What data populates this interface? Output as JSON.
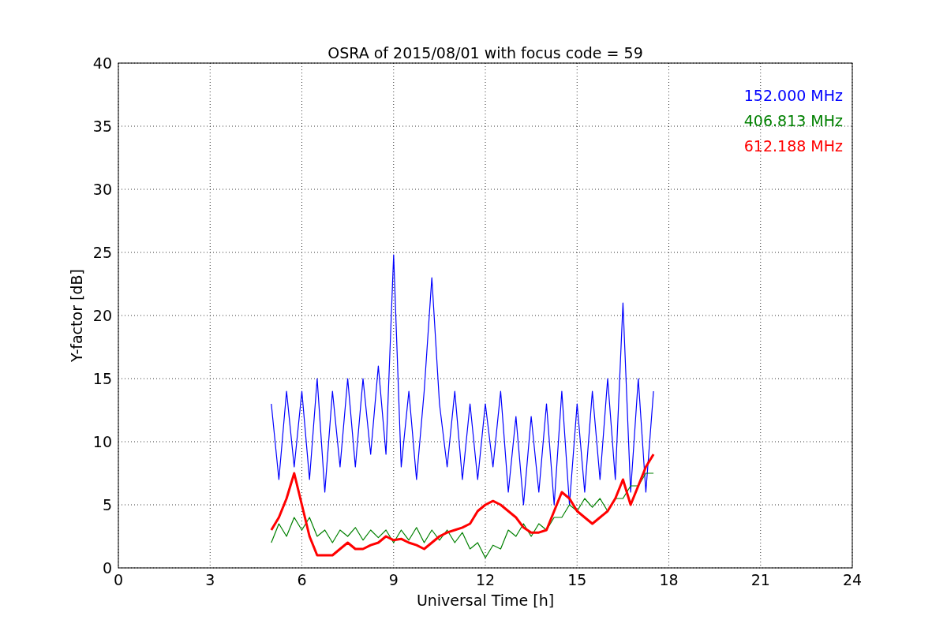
{
  "figure": {
    "chart_data": {
      "type": "line",
      "title": "OSRA of 2015/08/01 with focus code = 59",
      "xlabel": "Universal Time [h]",
      "ylabel": "Y-factor [dB]",
      "x": [
        5,
        5.25,
        5.5,
        5.75,
        6,
        6.25,
        6.5,
        6.75,
        7,
        7.25,
        7.5,
        7.75,
        8,
        8.25,
        8.5,
        8.75,
        9,
        9.25,
        9.5,
        9.75,
        10,
        10.25,
        10.5,
        10.75,
        11,
        11.25,
        11.5,
        11.75,
        12,
        12.25,
        12.5,
        12.75,
        13,
        13.25,
        13.5,
        13.75,
        14,
        14.25,
        14.5,
        14.75,
        15,
        15.25,
        15.5,
        15.75,
        16,
        16.25,
        16.5,
        16.75,
        17,
        17.25,
        17.5
      ],
      "series": [
        {
          "name": "152.000 MHz",
          "color": "#0000ff",
          "values": [
            13,
            7,
            14,
            8,
            14,
            7,
            15,
            6,
            14,
            8,
            15,
            8,
            15,
            9,
            16,
            9,
            24.8,
            8,
            14,
            7,
            14,
            23,
            13,
            8,
            14,
            7,
            13,
            7,
            13,
            8,
            14,
            6,
            12,
            5,
            12,
            6,
            13,
            5,
            14,
            5,
            13,
            6,
            14,
            7,
            15,
            7,
            21,
            6,
            15,
            6,
            14
          ]
        },
        {
          "name": "406.813 MHz",
          "color": "#008000",
          "values": [
            2,
            3.5,
            2.5,
            4,
            3,
            4,
            2.5,
            3,
            2,
            3,
            2.5,
            3.2,
            2.2,
            3,
            2.4,
            3,
            2,
            3,
            2.2,
            3.2,
            2,
            3,
            2.2,
            3,
            2,
            2.8,
            1.5,
            2,
            0.8,
            1.8,
            1.5,
            3,
            2.5,
            3.5,
            2.5,
            3.5,
            3,
            4,
            4,
            5,
            4.5,
            5.5,
            4.8,
            5.5,
            4.5,
            5.5,
            5.5,
            6.5,
            6.5,
            7.5,
            7.5
          ]
        },
        {
          "name": "612.188 MHz",
          "color": "#ff0000",
          "values": [
            3,
            4,
            5.5,
            7.5,
            5,
            2.5,
            1,
            1,
            1,
            1.5,
            2,
            1.5,
            1.5,
            1.8,
            2,
            2.5,
            2.2,
            2.3,
            2,
            1.8,
            1.5,
            2,
            2.5,
            2.8,
            3,
            3.2,
            3.5,
            4.5,
            5,
            5.3,
            5,
            4.5,
            4,
            3.2,
            2.8,
            2.8,
            3,
            4.5,
            6,
            5.5,
            4.5,
            4,
            3.5,
            4,
            4.5,
            5.5,
            7,
            5,
            6.5,
            8,
            9
          ]
        }
      ],
      "xlim": [
        0,
        24
      ],
      "ylim": [
        0,
        40
      ],
      "xticks": [
        0,
        3,
        6,
        9,
        12,
        15,
        18,
        21,
        24
      ],
      "yticks": [
        0,
        5,
        10,
        15,
        20,
        25,
        30,
        35,
        40
      ],
      "grid": true
    }
  }
}
